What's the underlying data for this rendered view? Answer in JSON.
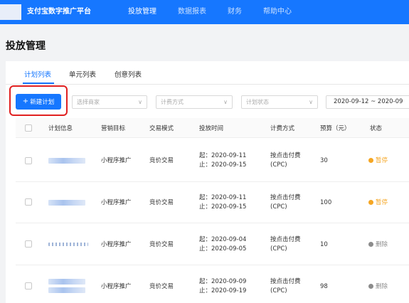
{
  "header": {
    "brand": "支付宝数字推广平台",
    "nav": [
      "投放管理",
      "数据报表",
      "财务",
      "帮助中心"
    ]
  },
  "page": {
    "title": "投放管理"
  },
  "tabs": [
    "计划列表",
    "单元列表",
    "创意列表"
  ],
  "toolbar": {
    "new_plan_label": "新建计划",
    "filters": [
      {
        "placeholder": "选择商家"
      },
      {
        "placeholder": "计费方式"
      },
      {
        "placeholder": "计划状态"
      }
    ],
    "date_range": "2020-09-12 ~ 2020-09"
  },
  "table": {
    "columns": [
      "计划信息",
      "营销目标",
      "交易模式",
      "投放时间",
      "计费方式",
      "预算（元）",
      "状态"
    ],
    "rows": [
      {
        "goal": "小程序推广",
        "mode": "竞价交易",
        "start": "起：2020-09-11",
        "end": "止：2020-09-15",
        "billing1": "按点击付费",
        "billing2": "(CPC)",
        "budget": "30",
        "status": "暂停"
      },
      {
        "goal": "小程序推广",
        "mode": "竞价交易",
        "start": "起：2020-09-11",
        "end": "止：2020-09-15",
        "billing1": "按点击付费",
        "billing2": "(CPC)",
        "budget": "100",
        "status": "暂停"
      },
      {
        "goal": "小程序推广",
        "mode": "竞价交易",
        "start": "起：2020-09-04",
        "end": "止：2020-09-05",
        "billing1": "按点击付费",
        "billing2": "(CPC)",
        "budget": "10",
        "status": "删除"
      },
      {
        "goal": "小程序推广",
        "mode": "竞价交易",
        "start": "起：2020-09-09",
        "end": "止：2020-09-19",
        "billing1": "按点击付费",
        "billing2": "(CPC)",
        "budget": "98",
        "status": "删除"
      }
    ]
  },
  "colors": {
    "primary": "#1677ff",
    "paused": "#f5a623",
    "deleted": "#8c8c8c",
    "highlight": "#e02020"
  }
}
